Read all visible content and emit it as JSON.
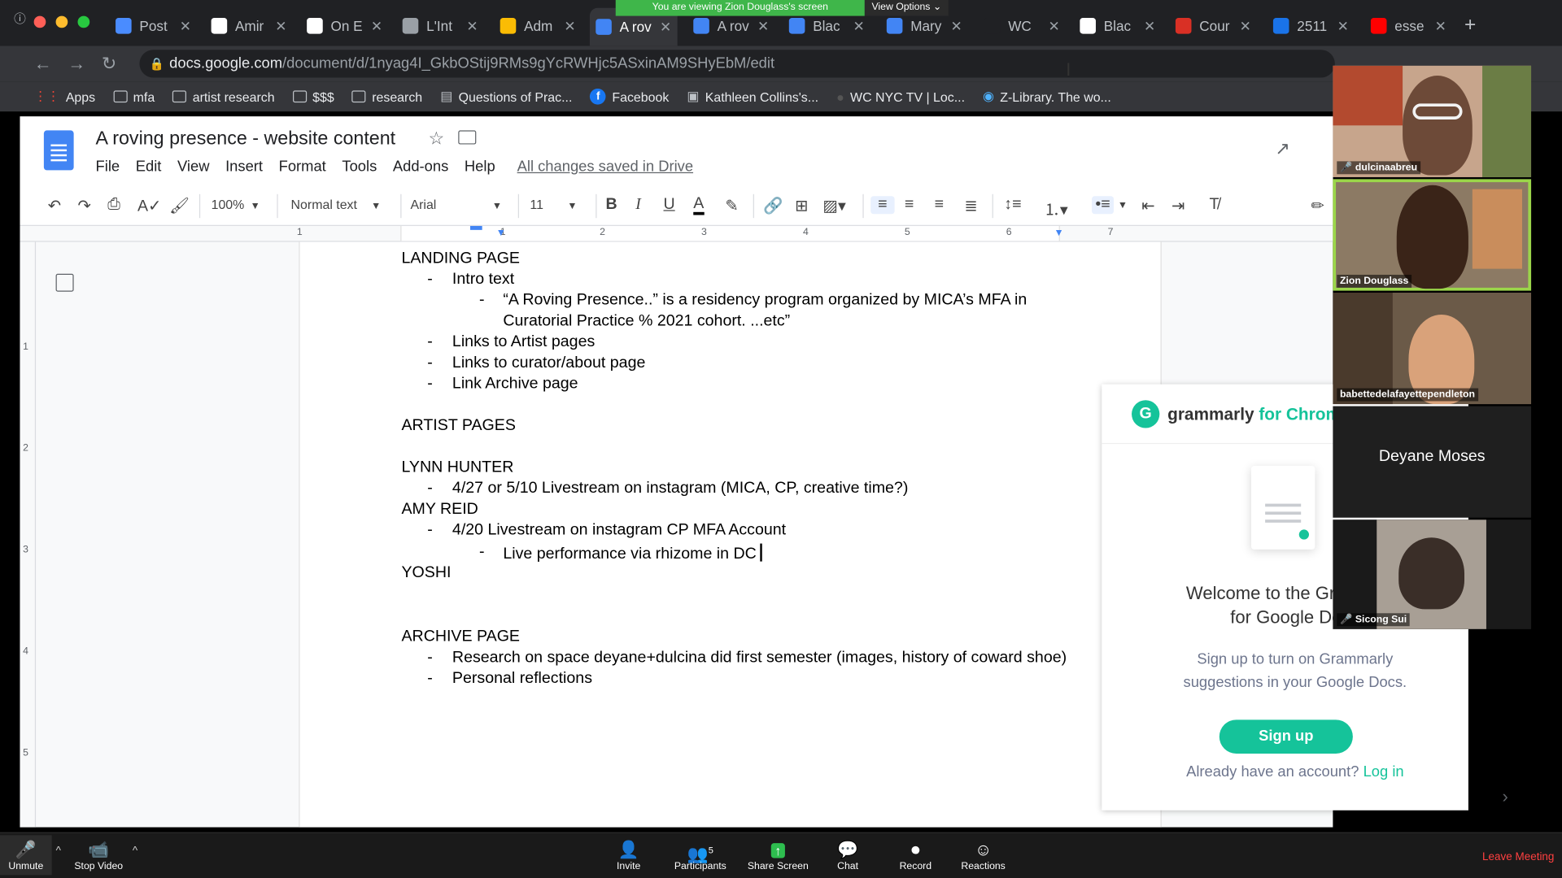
{
  "browser": {
    "tabs": [
      {
        "label": "Post",
        "color": "#4a8cff"
      },
      {
        "label": "Amir",
        "color": "#ffffff"
      },
      {
        "label": "On E",
        "color": "#ffffff"
      },
      {
        "label": "L'Int",
        "color": "#9aa0a6"
      },
      {
        "label": "Adm",
        "color": "#fbbc04"
      },
      {
        "label": "A rov",
        "color": "#4285f4",
        "active": true
      },
      {
        "label": "A rov",
        "color": "#4285f4"
      },
      {
        "label": "Blac",
        "color": "#4285f4"
      },
      {
        "label": "Mary",
        "color": "#4285f4"
      },
      {
        "label": "WC",
        "color": "#202124"
      },
      {
        "label": "Blac",
        "color": "#ffffff"
      },
      {
        "label": "Cour",
        "color": "#d93025"
      },
      {
        "label": "2511",
        "color": "#1a73e8"
      },
      {
        "label": "esse",
        "color": "#ff0000"
      }
    ],
    "share_banner": "You are viewing Zion Douglass's screen",
    "view_options": "View Options",
    "url_host": "docs.google.com",
    "url_path": "/document/d/1nyag4I_GkbOStij9RMs9gYcRWHjc5ASxinAM9SHyEbM/edit",
    "bookmarks": [
      "Apps",
      "mfa",
      "artist research",
      "$$$",
      "research",
      "Questions of Prac...",
      "Facebook",
      "Kathleen Collins's...",
      "WC NYC TV | Loc...",
      "Z-Library. The wo..."
    ]
  },
  "docs": {
    "title": "A roving presence - website content",
    "menu": [
      "File",
      "Edit",
      "View",
      "Insert",
      "Format",
      "Tools",
      "Add-ons",
      "Help"
    ],
    "saved": "All changes saved in Drive",
    "zoom": "100%",
    "style": "Normal text",
    "font": "Arial",
    "size": "11",
    "ruler_numbers": [
      "1",
      "1",
      "2",
      "3",
      "4",
      "5",
      "6",
      "7"
    ],
    "vruler_numbers": [
      "1",
      "2",
      "3",
      "4",
      "5"
    ],
    "lines": [
      {
        "text": "LANDING PAGE",
        "level": 0
      },
      {
        "text": "Intro text",
        "level": 1
      },
      {
        "text": "“A Roving Presence..” is a residency program organized by MICA’s MFA in",
        "level": 2
      },
      {
        "text": "Curatorial Practice % 2021 cohort. ...etc”",
        "level": 3
      },
      {
        "text": "Links to Artist pages",
        "level": 1
      },
      {
        "text": "Links to curator/about page",
        "level": 1
      },
      {
        "text": "Link Archive page",
        "level": 1
      },
      {
        "text": "ARTIST PAGES",
        "level": 0
      },
      {
        "text": "LYNN HUNTER",
        "level": 0
      },
      {
        "text": "4/27 or 5/10 Livestream on instagram (MICA, CP, creative time?)",
        "level": 1
      },
      {
        "text": "AMY REID",
        "level": 0
      },
      {
        "text": "4/20 Livestream on instagram CP MFA Account",
        "level": 1
      },
      {
        "text": "Live performance via rhizome in DC",
        "level": 2
      },
      {
        "text": "YOSHI",
        "level": 0
      },
      {
        "text": "ARCHIVE PAGE",
        "level": 0
      },
      {
        "text": "Research on space deyane+dulcina did first semester (images, history of coward shoe)",
        "level": 1
      },
      {
        "text": "Personal reflections",
        "level": 1
      }
    ]
  },
  "grammarly": {
    "brand": "grammarly",
    "brand_suffix": "for Chrome",
    "welcome_line1": "Welcome to the Grammarly",
    "welcome_line2": "for Google Docs",
    "sub_line1": "Sign up to turn on Grammarly",
    "sub_line2": "suggestions in your Google Docs.",
    "signup": "Sign up",
    "already": "Already have an account?",
    "login": "Log in"
  },
  "participants": [
    {
      "name": "dulcinaabreu",
      "muted": true
    },
    {
      "name": "Zion Douglass",
      "muted": false,
      "speaking": true
    },
    {
      "name": "babettedelafayettependleton",
      "muted": false
    },
    {
      "name": "Deyane Moses",
      "video_off": true
    },
    {
      "name": "Sicong Sui",
      "muted": true
    }
  ],
  "zoom_bar": {
    "unmute": "Unmute",
    "stop_video": "Stop Video",
    "invite": "Invite",
    "participants": "Participants",
    "participant_count": "5",
    "share": "Share Screen",
    "chat": "Chat",
    "record": "Record",
    "reactions": "Reactions",
    "leave": "Leave Meeting"
  }
}
